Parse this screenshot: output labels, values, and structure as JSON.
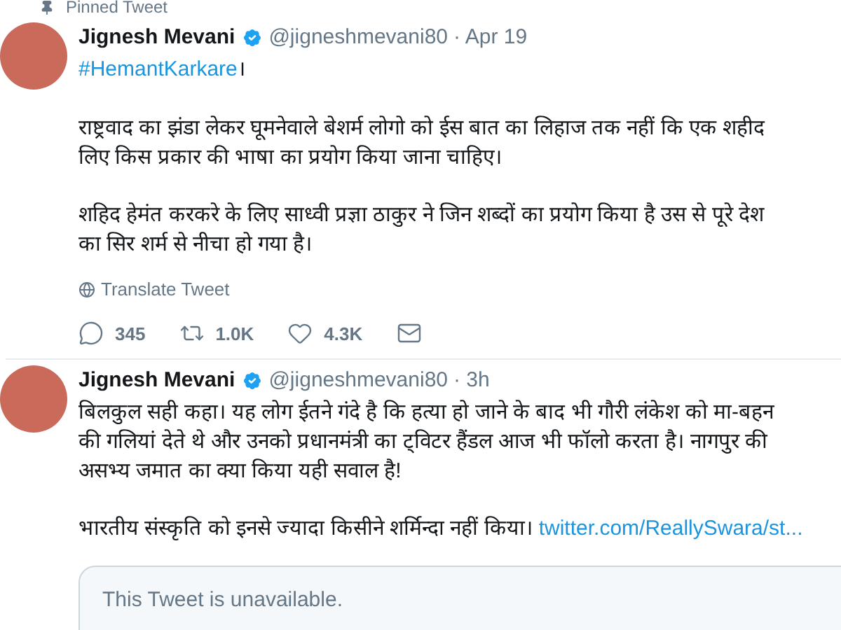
{
  "pinned_label": "Pinned Tweet",
  "tweets": [
    {
      "name": "Jignesh Mevani",
      "verified": true,
      "handle": "@jigneshmevani80",
      "time": "· Apr 19",
      "hashtag": "#HemantKarkare",
      "hashtag_suffix": "।",
      "paragraphs": [
        [
          "राष्ट्रवाद का झंडा लेकर घूमनेवाले बेशर्म लोगो को ईस बात का लिहाज तक नहीं कि एक शहीद",
          "लिए किस प्रकार की भाषा का प्रयोग किया जाना चाहिए।"
        ],
        [
          "शहिद हेमंत करकरे के लिए साध्वी प्रज्ञा ठाकुर ने जिन शब्दों का प्रयोग किया है उस से पूरे देश",
          "का सिर शर्म से नीचा हो गया है।"
        ]
      ],
      "translate": "Translate Tweet",
      "actions": [
        {
          "kind": "reply",
          "count": "345"
        },
        {
          "kind": "retweet",
          "count": "1.0K"
        },
        {
          "kind": "like",
          "count": "4.3K"
        },
        {
          "kind": "message"
        }
      ]
    },
    {
      "name": "Jignesh Mevani",
      "verified": true,
      "handle": "@jigneshmevani80",
      "time": "· 3h",
      "paragraphs": [
        [
          "बिलकुल सही कहा। यह लोग ईतने गंदे है कि हत्या हो जाने के बाद भी गौरी लंकेश को मा-बहन",
          "की गलियां देते थे और उनको प्रधानमंत्री का ट्विटर हैंडल आज भी फॉलो करता है। नागपुर की",
          "असभ्य जमात का क्या किया यही सवाल है!"
        ],
        [
          "भारतीय संस्कृति को इनसे ज्यादा किसीने शर्मिन्दा नहीं किया।"
        ]
      ],
      "link": "twitter.com/ReallySwara/st...",
      "quoted": "This Tweet is unavailable."
    }
  ]
}
